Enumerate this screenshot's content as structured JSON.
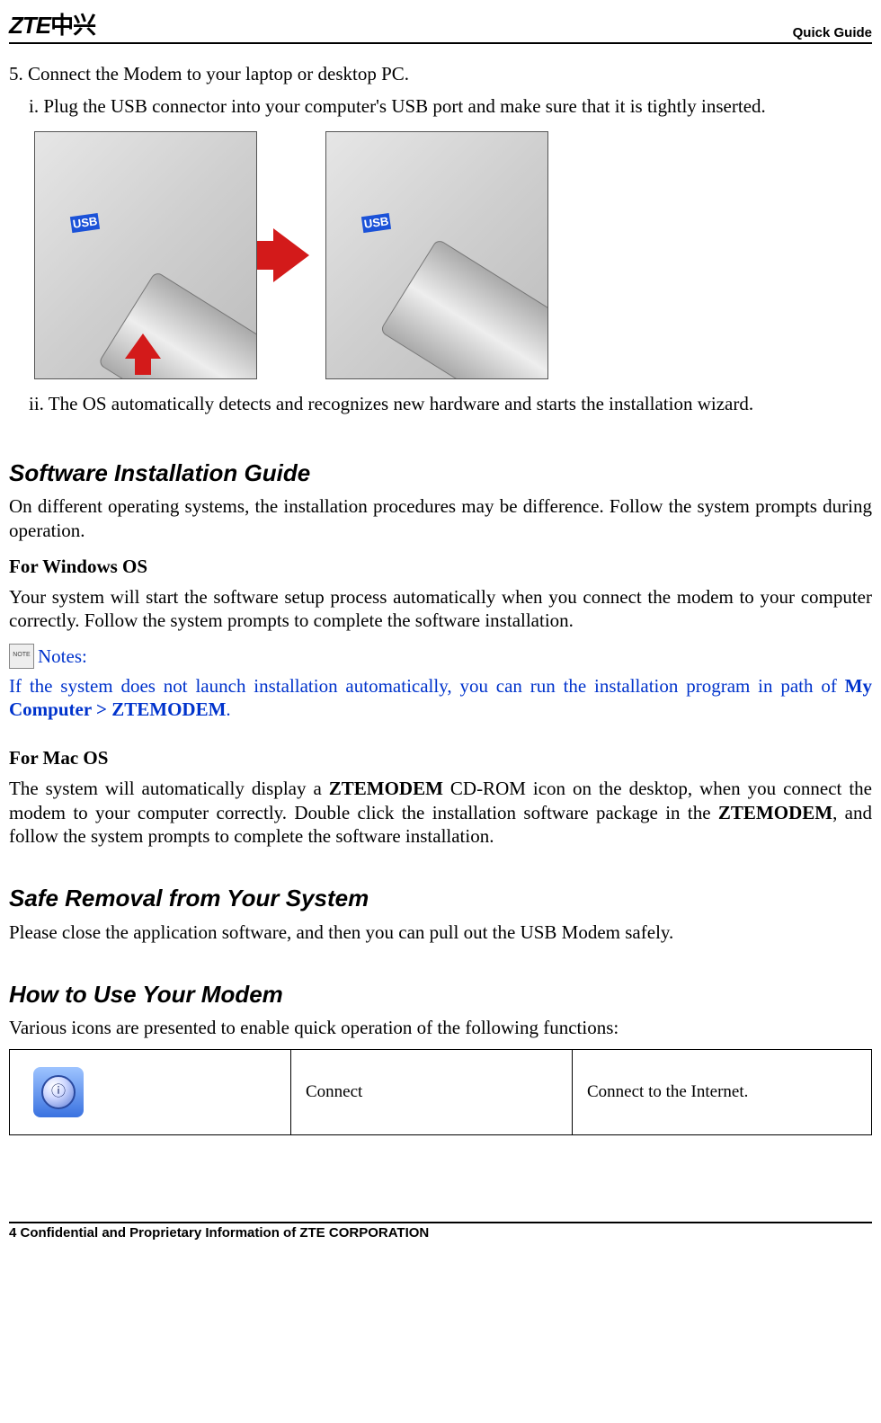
{
  "header": {
    "logo_main": "ZTE",
    "logo_cn": "中兴",
    "right": "Quick Guide"
  },
  "steps": {
    "step5": "5. Connect the Modem to your laptop or desktop PC.",
    "sub_i": "i. Plug the USB connector into your computer's USB port and make sure that it is tightly inserted.",
    "usb_label": "USB",
    "sub_ii": "ii. The OS automatically detects and recognizes new hardware and starts the installation wizard."
  },
  "section_install": {
    "title": "Software Installation Guide",
    "intro": "On different operating systems, the installation procedures may be difference. Follow the system prompts during operation.",
    "win_head": "For Windows OS",
    "win_body": "Your system will start the software setup process automatically when you connect the modem to your computer correctly. Follow the system prompts to complete the software installation.",
    "notes_label": "Notes:",
    "notes_body_a": "If the system does not launch installation automatically, you can run the installation program in path of ",
    "notes_path": "My Computer > ZTEMODEM",
    "notes_body_b": ".",
    "mac_head": "For Mac OS",
    "mac_body_a": "The system will automatically display a ",
    "mac_body_b_bold": "ZTEMODEM",
    "mac_body_c": " CD-ROM icon on the desktop, when you connect the modem to your computer correctly. Double click the installation software package in the ",
    "mac_body_d_bold": "ZTEMODEM",
    "mac_body_e": ", and follow the system prompts to complete the software installation."
  },
  "section_safe": {
    "title": "Safe Removal from Your System",
    "body": "Please close the application software, and then you can pull out the USB Modem safely."
  },
  "section_use": {
    "title": "How to Use Your Modem",
    "intro": "Various icons are presented to enable quick operation of the following functions:",
    "table": {
      "row1_name": "Connect",
      "row1_desc": "Connect to the Internet."
    }
  },
  "footer": {
    "pagenum": "4",
    "text": " Confidential and Proprietary Information of ZTE CORPORATION"
  }
}
